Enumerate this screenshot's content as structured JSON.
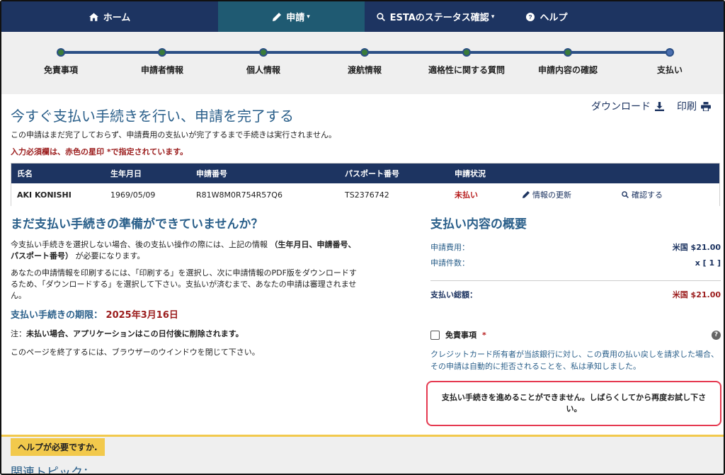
{
  "nav": {
    "home": "ホーム",
    "apply": "申請",
    "status": "ESTAのステータス確認",
    "help": "ヘルプ"
  },
  "steps": [
    "免責事項",
    "申請者情報",
    "個人情報",
    "渡航情報",
    "適格性に関する質問",
    "申請内容の確認",
    "支払い"
  ],
  "header": {
    "title": "今すぐ支払い手続きを行い、申請を完了する",
    "download": "ダウンロード",
    "print": "印刷",
    "notice": "この申請はまだ完了しておらず、申請費用の支払いが完了するまで手続きは実行されません。",
    "required": "入力必須欄は、赤色の星印 *で指定されています。"
  },
  "table": {
    "headers": [
      "氏名",
      "生年月日",
      "申請番号",
      "パスポート番号",
      "申請状況"
    ],
    "row": {
      "name": "AKI KONISHI",
      "dob": "1969/05/09",
      "app_number": "R81W8M0R754R57Q6",
      "passport": "TS2376742",
      "status": "未払い",
      "update": "情報の更新",
      "check": "確認する"
    }
  },
  "left": {
    "title": "まだ支払い手続きの準備ができていませんか？",
    "para1_a": "今支払い手続きを選択しない場合、後の支払い操作の際には、上記の情報 ",
    "para1_b": "（生年月日、申請番号、パスポート番号）",
    "para1_c": " が必要になります。",
    "para2": "あなたの申請情報を印刷するには、「印刷する」を選択し、次に申請情報のPDF版をダウンロードするため、「ダウンロードする」を選択して下さい。支払いが済むまで、あなたの申請は審理されません。",
    "deadline_label": "支払い手続きの期限：",
    "deadline_date": "2025年3月16日",
    "note_prefix": "注：",
    "note_text": "未払い場合、アプリケーションはこの日付後に削除されます。",
    "close_text": "このページを終了するには、ブラウザーのウインドウを閉じて下さい。"
  },
  "summary": {
    "title": "支払い内容の概要",
    "fee_label": "申請費用：",
    "fee_value": "米国 $21.00",
    "count_label": "申請件数：",
    "count_value": "x [ 1 ]",
    "total_label": "支払い総額：",
    "total_value": "米国 $21.00",
    "disclaimer_label": "免責事項",
    "disclaimer_star": "*",
    "help_icon": "?",
    "disclaimer_text": "クレジットカード所有者が当該銀行に対し、この費用の払い戻しを請求した場合、その申請は自動的に拒否されることを、私は承知しました。",
    "error": "支払い手続きを進めることができません。しばらくしてから再度お試し下さい。"
  },
  "footer": {
    "help_tab": "ヘルプが必要ですか.",
    "related": "関連トピック："
  },
  "colors": {
    "navy": "#1d3461",
    "teal_active": "#1f5a72",
    "title_blue": "#2a5f8a",
    "red": "#9b1c1c",
    "error_border": "#e53950",
    "footer_yellow": "#f2c94c"
  }
}
